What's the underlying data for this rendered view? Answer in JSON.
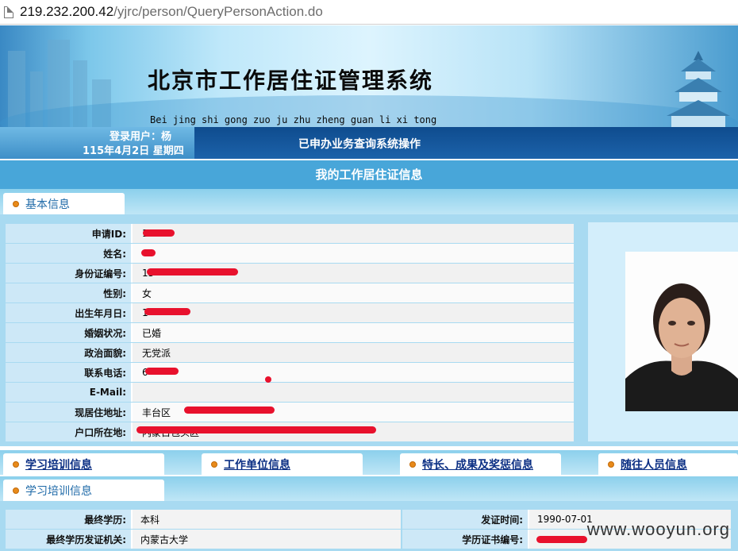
{
  "browser": {
    "url_host": "219.232.200.42",
    "url_path": "/yjrc/person/QueryPersonAction.do"
  },
  "header": {
    "title": "北京市工作居住证管理系统",
    "pinyin": "Bei jing shi gong zuo ju zhu zheng guan li xi tong"
  },
  "status": {
    "user": "登录用户：杨",
    "date": "115年4月2日 星期四",
    "operation": "已申办业务查询系统操作"
  },
  "page_title": "我的工作居住证信息",
  "sections": {
    "basic_tab": "基本信息",
    "training_tab": "学习培训信息"
  },
  "basic_info": [
    {
      "label": "申请ID:",
      "value": "1"
    },
    {
      "label": "姓名:",
      "value": ""
    },
    {
      "label": "身份证编号:",
      "value": "15"
    },
    {
      "label": "性别:",
      "value": "女"
    },
    {
      "label": "出生年月日:",
      "value": "1"
    },
    {
      "label": "婚姻状况:",
      "value": "已婚"
    },
    {
      "label": "政治面貌:",
      "value": "无党派"
    },
    {
      "label": "联系电话:",
      "value": "6"
    },
    {
      "label": "E-Mail:",
      "value": ""
    },
    {
      "label": "现居住地址:",
      "value": "丰台区"
    },
    {
      "label": "户口所在地:",
      "value": "内蒙古包头区"
    }
  ],
  "nav_tabs": [
    {
      "label": "学习培训信息"
    },
    {
      "label": "工作单位信息"
    },
    {
      "label": "特长、成果及奖惩信息"
    },
    {
      "label": "随往人员信息"
    }
  ],
  "training": {
    "row1": {
      "l1": "最终学历:",
      "v1": "本科",
      "l2": "发证时间:",
      "v2": "1990-07-01"
    },
    "row2": {
      "l1": "最终学历发证机关:",
      "v1": "内蒙古大学",
      "l2": "学历证书编号:",
      "v2": ""
    }
  },
  "watermark": "www.wooyun.org",
  "colors": {
    "accent_blue": "#48a6d9",
    "status_blue": "#1c62aa",
    "redaction": "#e8112d",
    "bullet": "#e88a1a"
  }
}
